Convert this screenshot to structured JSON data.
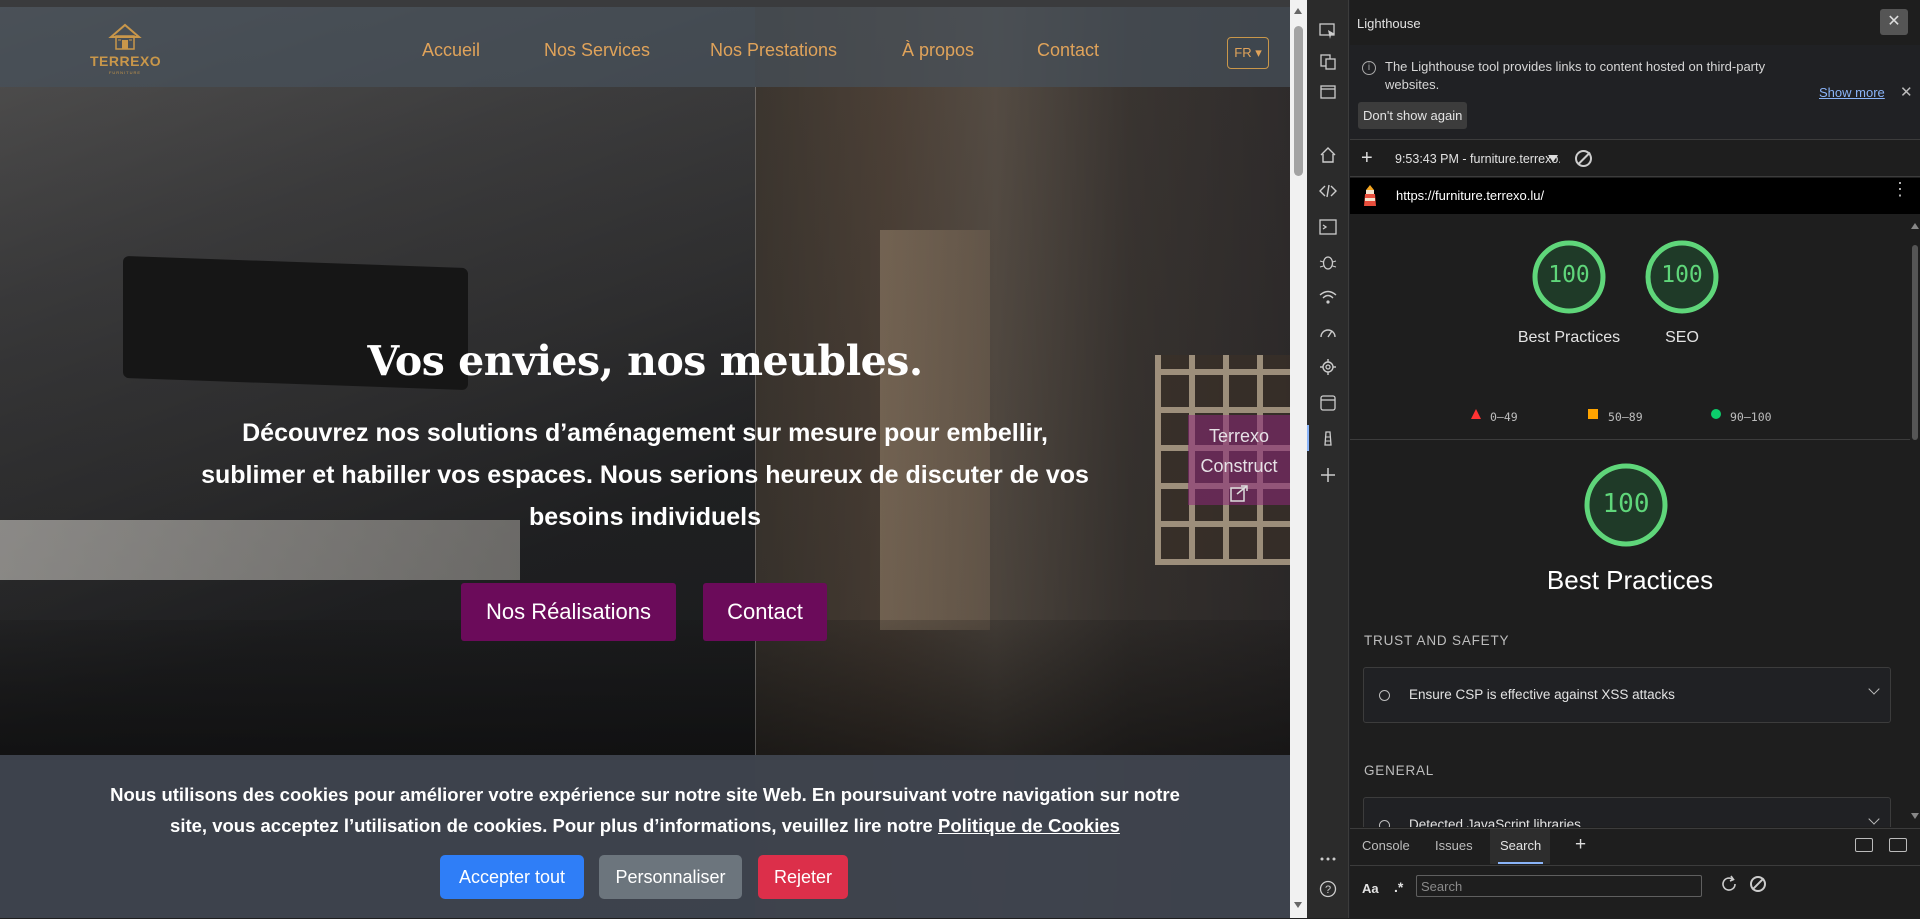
{
  "site": {
    "logo_text": "TERREXO",
    "logo_subtext": "FURNITURE",
    "nav": [
      "Accueil",
      "Nos Services",
      "Nos Prestations",
      "À propos",
      "Contact"
    ],
    "lang": "FR ▾",
    "hero_title": "Vos envies, nos meubles.",
    "hero_subtitle": "Découvrez nos solutions d’aménagement sur mesure pour embellir, sublimer et habiller vos espaces. Nous serions heureux de discuter de vos besoins individuels",
    "btn_realisations": "Nos Réalisations",
    "btn_contact": "Contact",
    "tag_line1": "Terrexo",
    "tag_line2": "Construct",
    "cookie_text": "Nous utilisons des cookies pour améliorer votre expérience sur notre site Web. En poursuivant votre navigation sur notre site, vous acceptez l’utilisation de cookies. Pour plus d’informations, veuillez lire notre",
    "cookie_link": "Politique de Cookies",
    "cookie_accept": "Accepter tout",
    "cookie_customize": "Personnaliser",
    "cookie_reject": "Rejeter",
    "colors": {
      "nav_link": "#e0a35a",
      "hero_button": "#6b0b5a",
      "accept": "#2f7ef7",
      "customize": "#6c757d",
      "reject": "#dc2f4a"
    }
  },
  "devtools": {
    "panel_title": "Lighthouse",
    "info_text": "The Lighthouse tool provides links to content hosted on third-party websites.",
    "show_more": "Show more",
    "dont_show": "Don't show again",
    "report_select": "9:53:43 PM - furniture.terrexo.lu",
    "url": "https://furniture.terrexo.lu/",
    "scores": [
      {
        "value": "100",
        "label": "Best Practices"
      },
      {
        "value": "100",
        "label": "SEO"
      }
    ],
    "legend": [
      "0–49",
      "50–89",
      "90–100"
    ],
    "category_score": "100",
    "category_title": "Best Practices",
    "group_trust": "TRUST AND SAFETY",
    "audit_csp": "Ensure CSP is effective against XSS attacks",
    "group_general": "GENERAL",
    "audit_js": "Detected JavaScript libraries",
    "drawer_tabs": [
      "Console",
      "Issues",
      "Search"
    ],
    "search_placeholder": "Search",
    "aa": "Aa",
    "regex": ".*",
    "score_color": "#5fd67a"
  }
}
